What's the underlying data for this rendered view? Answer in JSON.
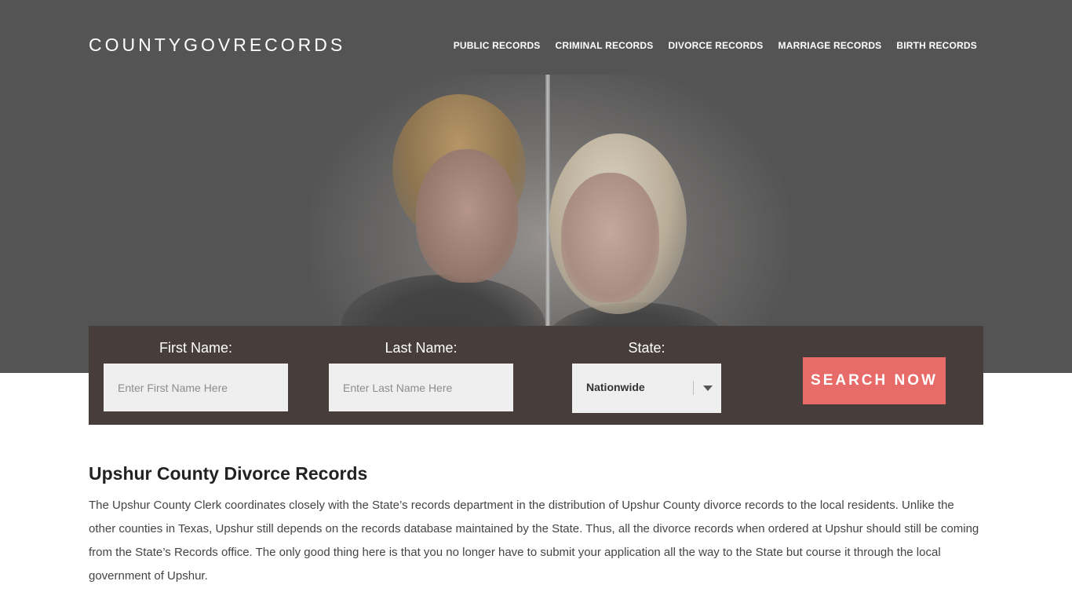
{
  "header": {
    "logo": "COUNTYGOVRECORDS",
    "nav": [
      {
        "label": "PUBLIC RECORDS"
      },
      {
        "label": "CRIMINAL RECORDS"
      },
      {
        "label": "DIVORCE RECORDS"
      },
      {
        "label": "MARRIAGE RECORDS"
      },
      {
        "label": "BIRTH RECORDS"
      }
    ]
  },
  "search": {
    "first_name_label": "First Name:",
    "first_name_placeholder": "Enter First Name Here",
    "first_name_value": "",
    "last_name_label": "Last Name:",
    "last_name_placeholder": "Enter Last Name Here",
    "last_name_value": "",
    "state_label": "State:",
    "state_selected": "Nationwide",
    "button_label": "SEARCH NOW"
  },
  "content": {
    "title": "Upshur County Divorce Records",
    "paragraph": "The Upshur County Clerk coordinates closely with the State’s records department in the distribution of Upshur County divorce records to the local residents. Unlike the other counties in Texas, Upshur still depends on the records database maintained by the State. Thus, all the divorce records when ordered at Upshur should still be coming from the State’s Records office. The only good thing here is that you no longer have to submit your application all the way to the State but course it through the local government of Upshur."
  },
  "colors": {
    "hero_bg": "#545454",
    "search_bar_bg": "#473d3b",
    "button_bg": "#e76b68"
  }
}
